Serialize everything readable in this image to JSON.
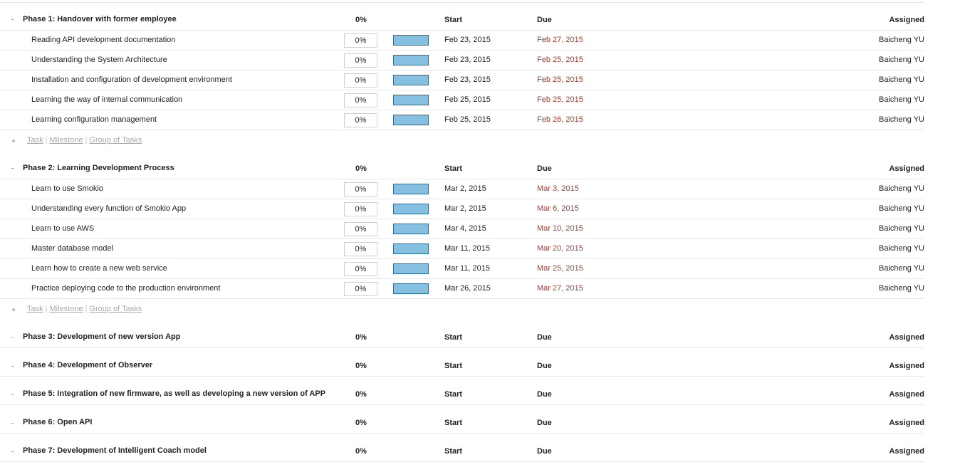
{
  "headers": {
    "start": "Start",
    "due": "Due",
    "assigned": "Assigned"
  },
  "add_links": {
    "task": "Task",
    "milestone": "Milestone",
    "group": "Group of Tasks",
    "separator": "|"
  },
  "phases": [
    {
      "title": "Phase 1: Handover with former employee",
      "percent": "0%",
      "tasks": [
        {
          "title": "Reading API development documentation",
          "percent": "0%",
          "progress": 1.0,
          "start": "Feb 23, 2015",
          "due": "Feb 27, 2015",
          "assigned": "Baicheng YU"
        },
        {
          "title": "Understanding the System Architecture",
          "percent": "0%",
          "progress": 1.0,
          "start": "Feb 23, 2015",
          "due": "Feb 25, 2015",
          "assigned": "Baicheng YU"
        },
        {
          "title": "Installation and configuration of development environment",
          "percent": "0%",
          "progress": 1.0,
          "start": "Feb 23, 2015",
          "due": "Feb 25, 2015",
          "assigned": "Baicheng YU"
        },
        {
          "title": "Learning the way of internal communication",
          "percent": "0%",
          "progress": 1.0,
          "start": "Feb 25, 2015",
          "due": "Feb 25, 2015",
          "assigned": "Baicheng YU"
        },
        {
          "title": "Learning configuration management",
          "percent": "0%",
          "progress": 1.0,
          "start": "Feb 25, 2015",
          "due": "Feb 26, 2015",
          "assigned": "Baicheng YU"
        }
      ]
    },
    {
      "title": "Phase 2: Learning Development Process",
      "percent": "0%",
      "tasks": [
        {
          "title": "Learn to use Smokio",
          "percent": "0%",
          "progress": 1.0,
          "start": "Mar 2, 2015",
          "due": "Mar 3, 2015",
          "assigned": "Baicheng YU"
        },
        {
          "title": "Understanding every function of Smokio App",
          "percent": "0%",
          "progress": 1.0,
          "start": "Mar 2, 2015",
          "due": "Mar 6, 2015",
          "assigned": "Baicheng YU"
        },
        {
          "title": "Learn to use AWS",
          "percent": "0%",
          "progress": 1.0,
          "start": "Mar 4, 2015",
          "due": "Mar 10, 2015",
          "assigned": "Baicheng YU"
        },
        {
          "title": "Master database model",
          "percent": "0%",
          "progress": 1.0,
          "start": "Mar 11, 2015",
          "due": "Mar 20, 2015",
          "assigned": "Baicheng YU"
        },
        {
          "title": "Learn how to create a new web service",
          "percent": "0%",
          "progress": 1.0,
          "start": "Mar 11, 2015",
          "due": "Mar 25, 2015",
          "assigned": "Baicheng YU"
        },
        {
          "title": "Practice deploying code to the production environment",
          "percent": "0%",
          "progress": 1.0,
          "start": "Mar 26, 2015",
          "due": "Mar 27, 2015",
          "assigned": "Baicheng YU"
        }
      ]
    },
    {
      "title": "Phase 3: Development of new version App",
      "percent": "0%",
      "tasks": []
    },
    {
      "title": "Phase 4: Development of Observer",
      "percent": "0%",
      "tasks": []
    },
    {
      "title": "Phase 5: Integration of new firmware, as well as developing a new version of APP",
      "percent": "0%",
      "tasks": []
    },
    {
      "title": "Phase 6: Open API",
      "percent": "0%",
      "tasks": []
    },
    {
      "title": "Phase 7: Development of Intelligent Coach model",
      "percent": "0%",
      "tasks": []
    }
  ],
  "colors": {
    "due_overdue": "#b03a30",
    "progress_fill": "#86c0e0",
    "progress_border": "#2f6f97"
  }
}
